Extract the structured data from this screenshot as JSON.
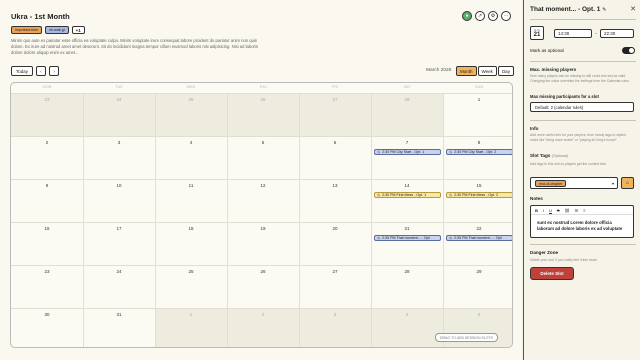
{
  "page": {
    "title": "Ukra - 1st Month",
    "tags": [
      {
        "label": "important-time",
        "color": "#e8a356"
      },
      {
        "label": "oh-wait-gi",
        "color": "#a9b9e3"
      }
    ],
    "add_tag_label": "+1",
    "description": "Minim quo aute ex pariatur esse officia ea voluptate culpa. Minim voluptate irure consequat labore proident do pariatur anim non quis dolore. Ex irure ad nostrud amet amet deserunt. Sit do incididunt magna tempor cillum eiusmod laboris nisi adipisicing. Nisi ad laboris dolore dolore aliquip enim ex amet..."
  },
  "top_icons": [
    "user-icon",
    "share-icon",
    "settings-icon",
    "more-icon"
  ],
  "toolbar": {
    "today_label": "Today",
    "prev_label": "‹",
    "next_label": "›",
    "month_label": "March 2026",
    "views": [
      "Month",
      "Week",
      "Day"
    ],
    "active_view": "Month"
  },
  "calendar": {
    "weekdays": [
      "MON",
      "TUE",
      "WED",
      "THU",
      "FRI",
      "SAT",
      "SUN"
    ],
    "weeks": [
      [
        {
          "day": "23",
          "other": true
        },
        {
          "day": "24",
          "other": true
        },
        {
          "day": "25",
          "other": true
        },
        {
          "day": "26",
          "other": true
        },
        {
          "day": "27",
          "other": true
        },
        {
          "day": "28",
          "other": true
        },
        {
          "day": "1",
          "other": false
        }
      ],
      [
        {
          "day": "2",
          "other": false
        },
        {
          "day": "3",
          "other": false
        },
        {
          "day": "4",
          "other": false
        },
        {
          "day": "5",
          "other": false
        },
        {
          "day": "6",
          "other": false
        },
        {
          "day": "7",
          "other": false,
          "event": {
            "text": "2:30 PM City Start - Opt. 1",
            "style": "blue"
          }
        },
        {
          "day": "8",
          "other": false,
          "event": {
            "text": "2:30 PM City Start - Opt. 2",
            "style": "blue"
          }
        }
      ],
      [
        {
          "day": "9",
          "other": false
        },
        {
          "day": "10",
          "other": false
        },
        {
          "day": "11",
          "other": false
        },
        {
          "day": "12",
          "other": false
        },
        {
          "day": "13",
          "other": false
        },
        {
          "day": "14",
          "other": false,
          "event": {
            "text": "2:30 PM First Mess - Opt. 1",
            "style": "yellow"
          }
        },
        {
          "day": "15",
          "other": false,
          "event": {
            "text": "2:30 PM First Mess - Opt. 2",
            "style": "yellow"
          }
        }
      ],
      [
        {
          "day": "16",
          "other": false
        },
        {
          "day": "17",
          "other": false
        },
        {
          "day": "18",
          "other": false
        },
        {
          "day": "19",
          "other": false
        },
        {
          "day": "20",
          "other": false
        },
        {
          "day": "21",
          "other": false,
          "event": {
            "text": "2:30 PM That moment... - Opt",
            "style": "blue"
          }
        },
        {
          "day": "22",
          "other": false,
          "event": {
            "text": "2:30 PM That moment... - Opt",
            "style": "blue"
          }
        }
      ],
      [
        {
          "day": "23",
          "other": false
        },
        {
          "day": "24",
          "other": false
        },
        {
          "day": "25",
          "other": false
        },
        {
          "day": "26",
          "other": false
        },
        {
          "day": "27",
          "other": false
        },
        {
          "day": "28",
          "other": false
        },
        {
          "day": "29",
          "other": false
        }
      ],
      [
        {
          "day": "30",
          "other": false
        },
        {
          "day": "31",
          "other": false
        },
        {
          "day": "1",
          "other": true
        },
        {
          "day": "2",
          "other": true
        },
        {
          "day": "3",
          "other": true
        },
        {
          "day": "4",
          "other": true
        },
        {
          "day": "5",
          "other": true
        }
      ]
    ],
    "drag_label": "DRAG TO ADD SESSION SLOTS"
  },
  "panel": {
    "title": "That moment... - Opt. 1",
    "edit_icon": "pencil-icon",
    "close_label": "✕",
    "date_month": "MAR",
    "date_day": "21",
    "start_time": "14:30",
    "end_time": "22:30",
    "time_separator": "-",
    "optional_label": "Mark as optional",
    "max_missing_title": "Max. missing players",
    "max_missing_help": "How many players can be missing to still count this slot as valid. Changing the value overrides the settings from the Calendar rules.",
    "max_missing_select_label": "Max missing participants for a slot",
    "max_missing_value": "Default: 2 (calendar rules)",
    "info_title": "Info",
    "info_help": "Add more useful info for your players, from handy tags to stylish notes like \"bring more snake\" or \"playing at Greg's house\"",
    "slot_tags_label": "Slot Tags",
    "slot_tags_optional": "(Optional)",
    "slot_tags_help": "Add tags to this slot so players get the context fast.",
    "slot_tag_value": "end-of-chapter",
    "notes_label": "Notes",
    "notes_text": "sunt ex nostrud Lorem dolore officia laborum ad dolore laboris ex ad voluptate",
    "danger_title": "Danger Zone",
    "danger_help": "Delete your slot, if you really feel it this much",
    "delete_label": "Delete Slot"
  }
}
